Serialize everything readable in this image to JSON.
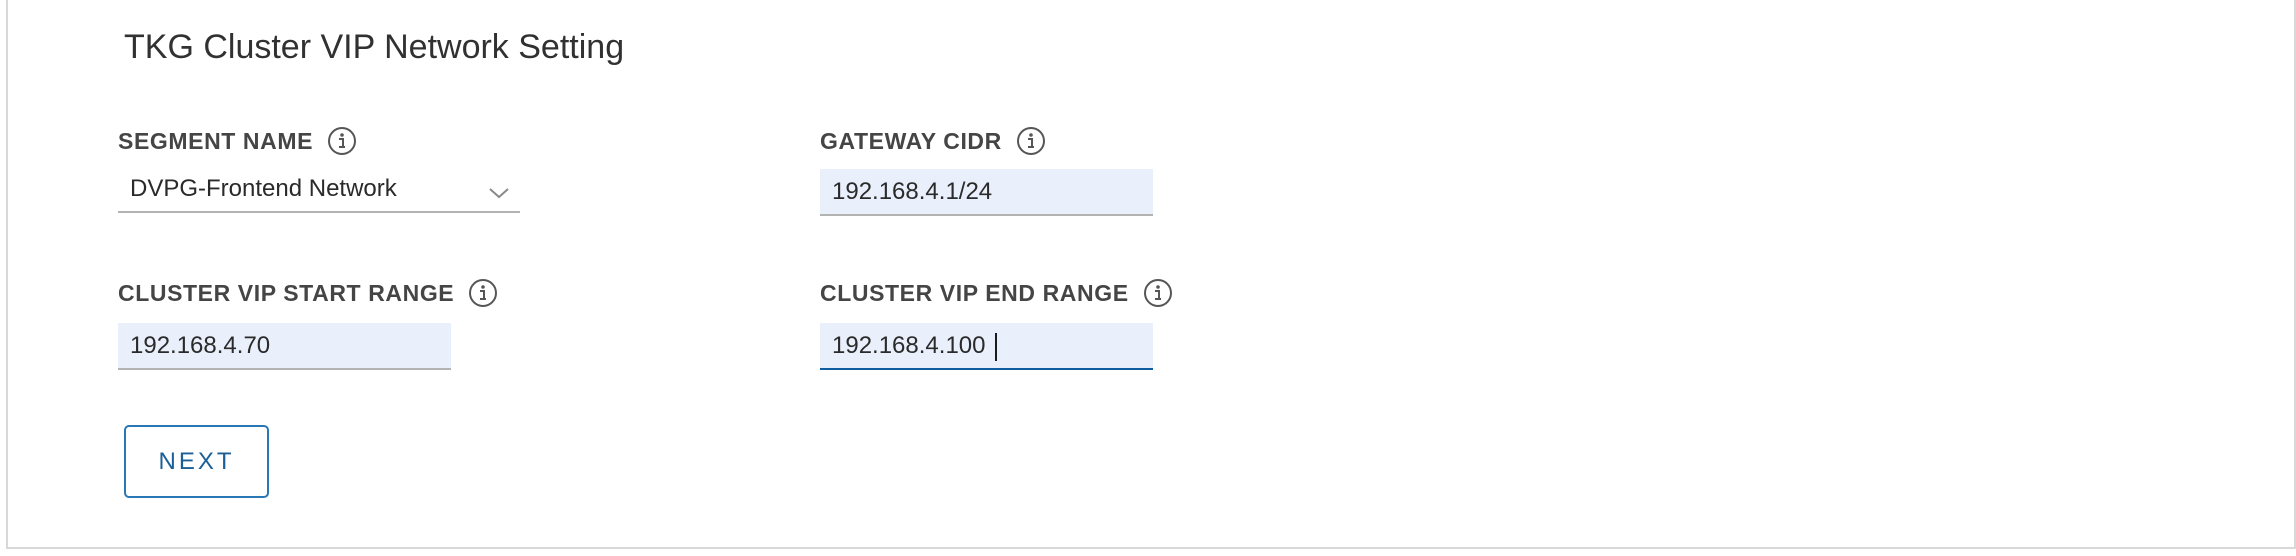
{
  "section": {
    "title": "TKG Cluster VIP Network Setting"
  },
  "fields": {
    "segment_name": {
      "label": "SEGMENT NAME",
      "value": "DVPG-Frontend Network",
      "icon": "info-icon"
    },
    "gateway_cidr": {
      "label": "GATEWAY CIDR",
      "value": "192.168.4.1/24",
      "icon": "info-icon"
    },
    "vip_start": {
      "label": "CLUSTER VIP START RANGE",
      "value": "192.168.4.70",
      "icon": "info-icon"
    },
    "vip_end": {
      "label": "CLUSTER VIP END RANGE",
      "value": "192.168.4.100",
      "icon": "info-icon"
    }
  },
  "actions": {
    "next_label": "NEXT"
  },
  "colors": {
    "input_background": "#e9f0fb",
    "focus_underline": "#0f5d9e",
    "button_accent": "#2a77b5"
  }
}
